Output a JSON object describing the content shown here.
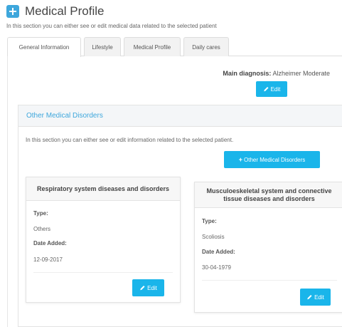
{
  "header": {
    "title": "Medical Profile",
    "subtitle": "In this section you can either see or edit medical data related to the selected patient"
  },
  "tabs": [
    {
      "label": "General Information",
      "active": true
    },
    {
      "label": "Lifestyle",
      "active": false
    },
    {
      "label": "Medical Profile",
      "active": false
    },
    {
      "label": "Daily cares",
      "active": false
    }
  ],
  "main_diagnosis": {
    "label": "Main diagnosis:",
    "value": "Alzheimer Moderate",
    "edit_label": "Edit"
  },
  "other_disorders": {
    "title": "Other Medical Disorders",
    "description": "In this section you can either see or edit information related to the selected patient.",
    "add_button": "Other Medical Disorders",
    "cards": [
      {
        "title": "Respiratory system diseases and disorders",
        "type_label": "Type:",
        "type_value": "Others",
        "date_label": "Date Added:",
        "date_value": "12-09-2017",
        "edit_label": "Edit"
      },
      {
        "title": "Musculoeskeletal system and connective tissue diseases and disorders",
        "type_label": "Type:",
        "type_value": "Scoliosis",
        "date_label": "Date Added:",
        "date_value": "30-04-1979",
        "edit_label": "Edit"
      }
    ]
  },
  "colors": {
    "accent": "#1ab5ea",
    "header_icon": "#3ea7dc",
    "panel_title": "#3ea7dc"
  },
  "icons": [
    "plus-square-icon",
    "pencil-icon",
    "plus-icon"
  ]
}
